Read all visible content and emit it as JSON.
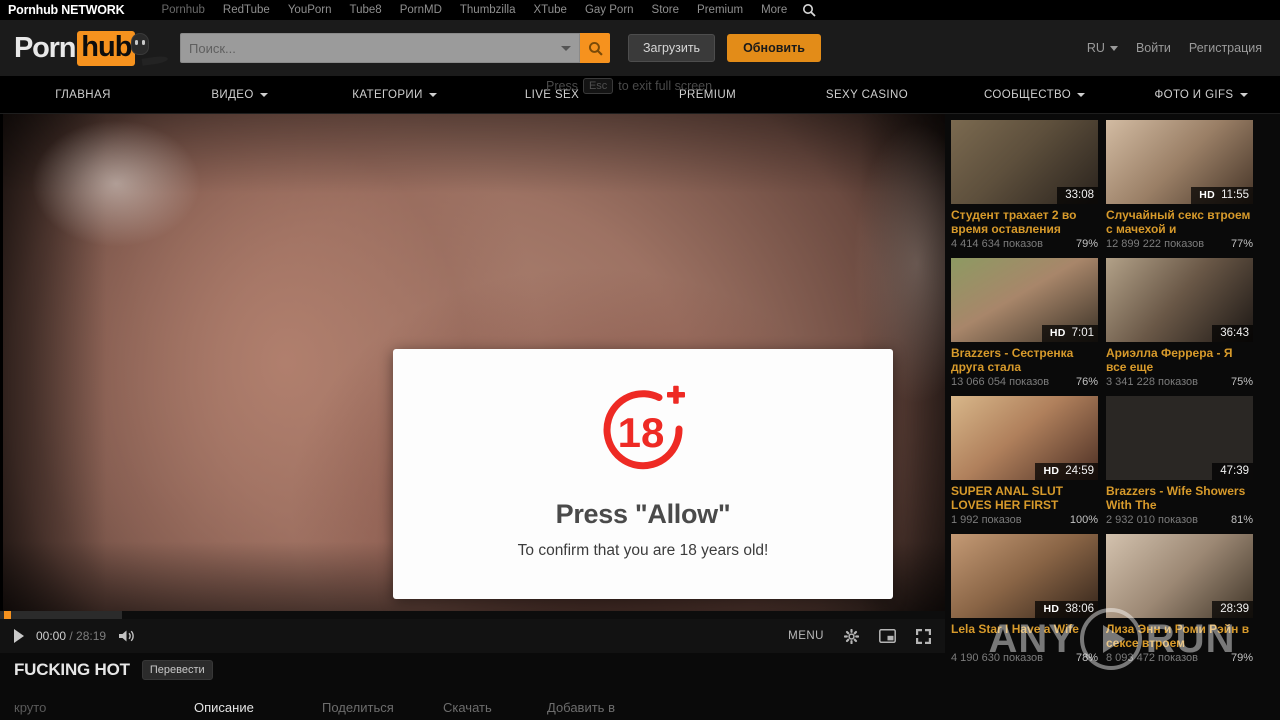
{
  "network_bar": {
    "brand": "Pornhub NETWORK",
    "links": [
      "Pornhub",
      "RedTube",
      "YouPorn",
      "Tube8",
      "PornMD",
      "Thumbzilla",
      "XTube",
      "Gay Porn",
      "Store",
      "Premium",
      "More"
    ],
    "search_icon": "search-icon"
  },
  "header": {
    "logo": {
      "part1": "Porn",
      "part2": "hub"
    },
    "search": {
      "value": "",
      "placeholder": "Поиск..."
    },
    "upload_label": "Загрузить",
    "update_label": "Обновить",
    "language": "RU",
    "login_label": "Войти",
    "register_label": "Регистрация"
  },
  "fullscreen_toast": {
    "before": "Press",
    "key": "Esc",
    "after": "to exit full screen"
  },
  "main_nav": [
    {
      "label": "ГЛАВНАЯ",
      "caret": false
    },
    {
      "label": "ВИДЕО",
      "caret": true
    },
    {
      "label": "КАТЕГОРИИ",
      "caret": true
    },
    {
      "label": "LIVE SEX",
      "caret": false
    },
    {
      "label": "PREMIUM",
      "caret": false
    },
    {
      "label": "SEXY CASINO",
      "caret": false
    },
    {
      "label": "СООБЩЕСТВО",
      "caret": true
    },
    {
      "label": "ФОТО И GIFS",
      "caret": true
    }
  ],
  "modal": {
    "badge": "18",
    "badge_plus": "+",
    "title": "Press \"Allow\"",
    "subtitle": "To confirm that you are 18 years old!"
  },
  "player": {
    "current_time": "00:00",
    "separator": " / ",
    "total_time": "28:19",
    "menu_label": "MENU",
    "play_icon": "play-icon",
    "volume_icon": "volume-icon",
    "settings_icon": "gear-icon",
    "pip_icon": "picture-in-picture-icon",
    "fullscreen_icon": "fullscreen-icon",
    "video_title": "FUCKING HOT",
    "translate_label": "Перевести"
  },
  "tabs": {
    "cool_label": "круто",
    "items": [
      {
        "label": "Описание",
        "active": true
      },
      {
        "label": "Поделиться",
        "active": false
      },
      {
        "label": "Скачать",
        "active": false
      },
      {
        "label": "Добавить в",
        "active": false
      }
    ]
  },
  "sidebar": {
    "videos": [
      {
        "title": "Студент трахает 2 во время оставления",
        "views": "4 414 634 показов",
        "rating": "79%",
        "duration": "33:08",
        "hd": false,
        "thumb_a": "#6e5a48",
        "thumb_b": "#2b2420"
      },
      {
        "title": "Случайный секс втроем с мачехой и",
        "views": "12 899 222 показов",
        "rating": "77%",
        "duration": "11:55",
        "hd": true,
        "thumb_a": "#b79c84",
        "thumb_b": "#4a3a2e"
      },
      {
        "title": "Brazzers - Сестренка друга стала",
        "views": "13 066 054 показов",
        "rating": "76%",
        "duration": "7:01",
        "hd": true,
        "thumb_a": "#9a7b63",
        "thumb_b": "#3a4a32"
      },
      {
        "title": "Ариэлла Феррера - Я все еще",
        "views": "3 341 228 показов",
        "rating": "75%",
        "duration": "36:43",
        "hd": false,
        "thumb_a": "#8a7158",
        "thumb_b": "#211c18"
      },
      {
        "title": "SUPER ANAL SLUT LOVES HER FIRST",
        "views": "1 992 показов",
        "rating": "100%",
        "duration": "24:59",
        "hd": true,
        "thumb_a": "#c29a74",
        "thumb_b": "#5c3a2c"
      },
      {
        "title": "Brazzers - Wife Showers With The",
        "views": "2 932 010 показов",
        "rating": "81%",
        "duration": "47:39",
        "hd": false,
        "thumb_a": "#cbb4a2",
        "thumb_b": "#7a6a5e"
      },
      {
        "title": "Lela Star I Have a Wife",
        "views": "4 190 630 показов",
        "rating": "78%",
        "duration": "38:06",
        "hd": true,
        "thumb_a": "#b08a6c",
        "thumb_b": "#4a3628"
      },
      {
        "title": "Лиза Энн и Роми Рэйн в сексе втроем",
        "views": "8 093 472 показов",
        "rating": "79%",
        "duration": "28:39",
        "hd": false,
        "thumb_a": "#bca894",
        "thumb_b": "#534438"
      }
    ]
  },
  "watermark": {
    "left": "ANY",
    "right": "RUN",
    "icon": "play-circle-icon"
  },
  "colors": {
    "accent": "#f6921e",
    "title_orange": "#d79a2b",
    "badge_red": "#ee2a24",
    "header_bg": "#1b1b1b"
  }
}
